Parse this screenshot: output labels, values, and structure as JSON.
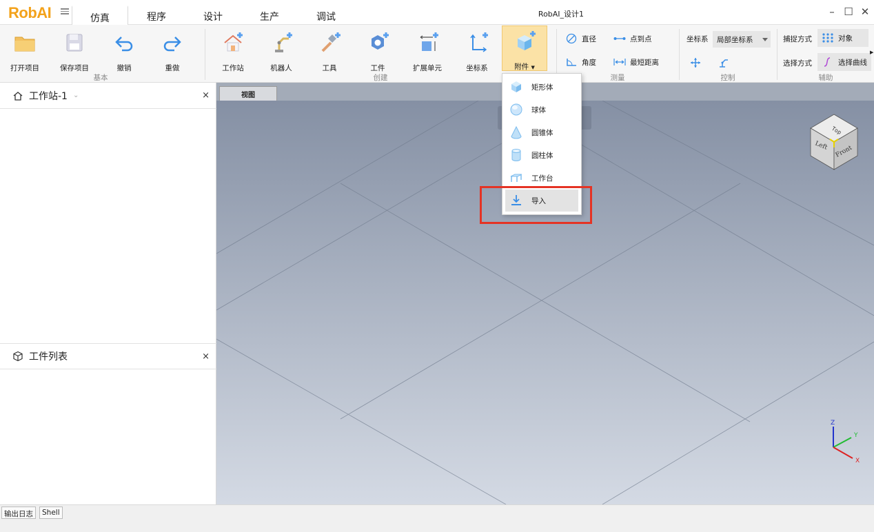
{
  "app": {
    "logo": "RobAI",
    "window_title": "RobAI_设计1"
  },
  "main_tabs": [
    {
      "label": "仿真",
      "active": true
    },
    {
      "label": "程序"
    },
    {
      "label": "设计"
    },
    {
      "label": "生产"
    },
    {
      "label": "调试"
    }
  ],
  "ribbon": {
    "basic": {
      "open": "打开项目",
      "save": "保存项目",
      "undo": "撤销",
      "redo": "重做",
      "group": "基本"
    },
    "create": {
      "workstation": "工作站",
      "robot": "机器人",
      "tool": "工具",
      "workpiece": "工件",
      "ext_unit": "扩展单元",
      "coord": "坐标系",
      "attach": "附件",
      "group": "创建"
    },
    "measure": {
      "diameter": "直径",
      "p2p": "点到点",
      "angle": "角度",
      "shortest": "最短距离",
      "group": "测量"
    },
    "control": {
      "coord_label": "坐标系",
      "coord_value": "局部坐标系",
      "group": "控制"
    },
    "assist": {
      "snap_label": "捕捉方式",
      "snap_value": "对象",
      "select_label": "选择方式",
      "select_value": "选择曲线",
      "group": "辅助"
    }
  },
  "left_panels": {
    "workstation": {
      "title": "工作站-1",
      "close": "×"
    },
    "workpieces": {
      "title": "工件列表",
      "close": "×"
    }
  },
  "viewport": {
    "tab": "视图",
    "cube": {
      "top": "Top",
      "left": "Left",
      "front": "Front"
    },
    "axes": {
      "z": "Z",
      "y": "Y",
      "x": "X"
    }
  },
  "attach_menu": {
    "items": [
      "矩形体",
      "球体",
      "圆锥体",
      "圆柱体",
      "工作台",
      "导入"
    ],
    "hovered_index": 5
  },
  "bottom_tabs": [
    "输出日志",
    "Shell"
  ],
  "colors": {
    "accent": "#f3a21b",
    "highlight": "#e53324",
    "icon_blue": "#3a8ee6"
  }
}
